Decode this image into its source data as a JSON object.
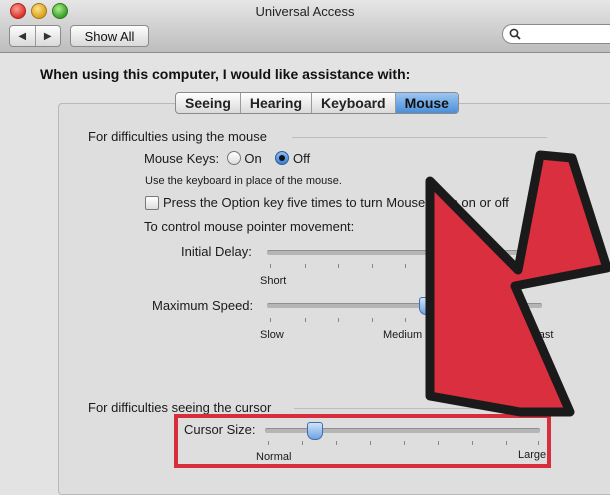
{
  "window": {
    "title": "Universal Access",
    "nav_back": "◀",
    "nav_forward": "▶",
    "show_all_label": "Show All",
    "search_placeholder": ""
  },
  "heading": "When using this computer, I would like assistance with:",
  "tabs": [
    {
      "label": "Seeing",
      "active": false
    },
    {
      "label": "Hearing",
      "active": false
    },
    {
      "label": "Keyboard",
      "active": false
    },
    {
      "label": "Mouse",
      "active": true
    }
  ],
  "mouse_section": {
    "label": "For difficulties using the mouse",
    "mouse_keys_label": "Mouse Keys:",
    "on_label": "On",
    "off_label": "Off",
    "selected": "Off",
    "mouse_keys_help": "Use the keyboard in place of the mouse.",
    "option_key_checkbox": "Press the Option key five times to turn Mouse Keys on or off",
    "option_key_checked": false,
    "pointer_movement_label": "To control mouse pointer movement:",
    "initial_delay": {
      "label": "Initial Delay:",
      "min_label": "Short",
      "max_label": ""
    },
    "maximum_speed": {
      "label": "Maximum Speed:",
      "min_label": "Slow",
      "mid_label": "Medium",
      "max_label": "Fast",
      "value_fraction": 0.62
    }
  },
  "cursor_section": {
    "label": "For difficulties seeing the cursor",
    "cursor_size": {
      "label": "Cursor Size:",
      "min_label": "Normal",
      "max_label": "Large",
      "value_fraction": 0.17
    }
  },
  "colors": {
    "accent_blue": "#4b8fd8",
    "highlight_red": "#d72e3d",
    "arrow_fill": "#d92f3f",
    "arrow_stroke": "#1a1a1a"
  }
}
